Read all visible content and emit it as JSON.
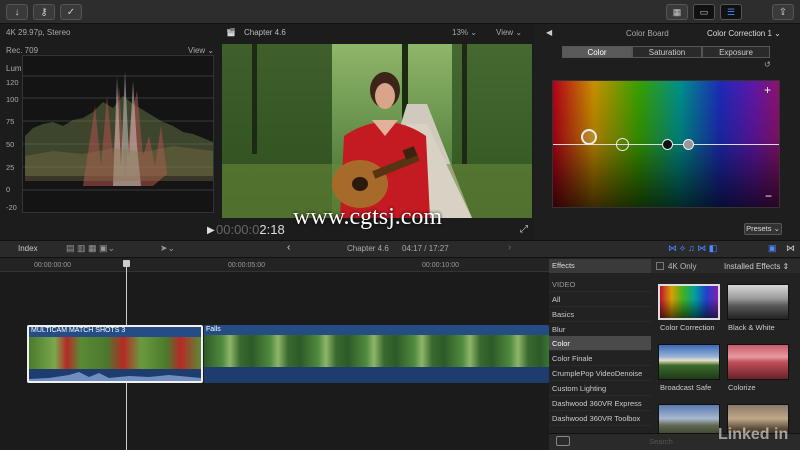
{
  "toolbar": {
    "import_icon": "download-arrow-icon",
    "keyword_icon": "key-icon",
    "check_icon": "checkmark-icon",
    "share_icon": "share-icon"
  },
  "viewer": {
    "format": "4K 29.97p, Stereo",
    "title": "Chapter 4.6",
    "zoom": "13%",
    "view_label": "View",
    "timecode": "2:18",
    "watermark": "www.cgtsj.com"
  },
  "scope": {
    "profile": "Rec. 709",
    "view_label": "View",
    "mode": "Luma",
    "ticks": [
      "120",
      "100",
      "75",
      "50",
      "25",
      "0",
      "-20"
    ]
  },
  "inspector": {
    "title": "Color Board",
    "correction": "Color Correction 1",
    "tabs": [
      "Color",
      "Saturation",
      "Exposure"
    ],
    "plus": "+",
    "minus": "−",
    "presets": "Presets"
  },
  "timeline": {
    "index_label": "Index",
    "chapter": "Chapter 4.6",
    "position": "04:17 / 17:27",
    "ruler": [
      "00:00:00:00",
      "00:00:05:00",
      "00:00:10:00"
    ],
    "clip1": "MULTICAM MATCH SHOTS 3",
    "clip2": "Falls"
  },
  "effects": {
    "header": "Effects",
    "four_k_only": "4K Only",
    "installed": "Installed Effects",
    "section": "VIDEO",
    "categories": [
      "All",
      "Basics",
      "Blur",
      "Color",
      "Color Finale",
      "CrumplePop VideoDenoise",
      "Custom Lighting",
      "Dashwood 360VR Express",
      "Dashwood 360VR Toolbox"
    ],
    "selected": "Color",
    "items": [
      "Color Correction",
      "Black & White",
      "Broadcast Safe",
      "Colorize"
    ],
    "search_placeholder": "Search",
    "brand": "Linked in"
  },
  "colors": {
    "accent": "#3f7bd9",
    "clip_blue": "#264c86",
    "clip_selected_border": "#f0f0f0"
  }
}
